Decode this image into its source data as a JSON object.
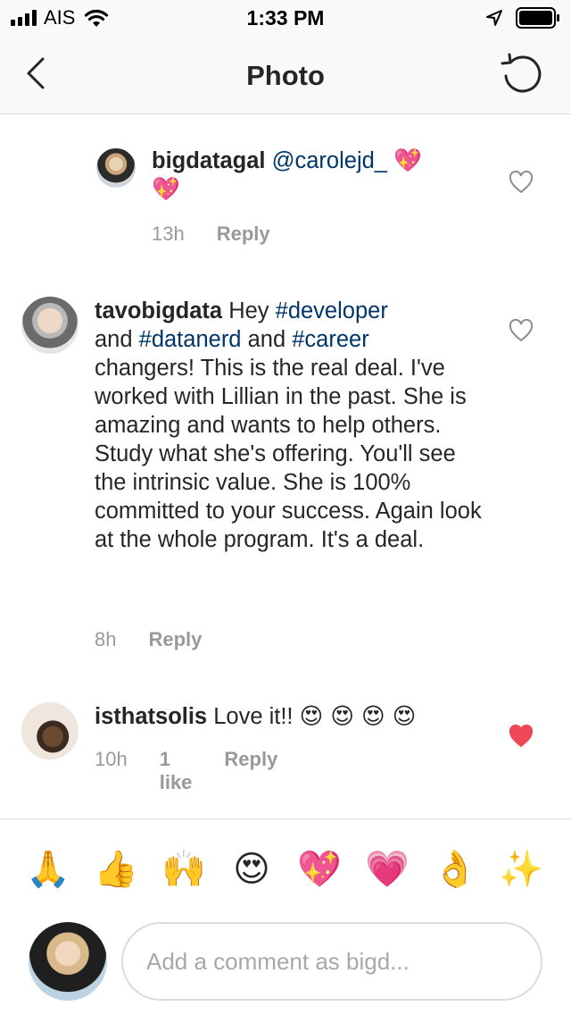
{
  "status_bar": {
    "carrier": "AIS",
    "time": "1:33 PM",
    "icons": [
      "signal-icon",
      "wifi-icon",
      "location-arrow-icon",
      "battery-icon"
    ]
  },
  "nav": {
    "title": "Photo",
    "back_icon": "chevron-left-icon",
    "refresh_icon": "refresh-icon"
  },
  "comments": [
    {
      "username": "bigdatagal",
      "mention": "@carolejd_",
      "emoji": "💖",
      "emoji2": "💖",
      "time": "13h",
      "reply": "Reply",
      "liked": false
    },
    {
      "username": "tavobigdata",
      "text_1": "Hey ",
      "tag_1": "#developer",
      "text_2": "and ",
      "tag_2": "#datanerd",
      "text_3": " and ",
      "tag_3": "#career",
      "text_4": "changers!  This is the real deal. I've worked with Lillian in the past.  She is amazing and wants to help others.  Study what she's offering.  You'll see the intrinsic value.  She is 100% committed to your success.  Again look at the whole program.  It's a deal.",
      "time": "8h",
      "reply": "Reply",
      "liked": false
    },
    {
      "username": "isthatsolis",
      "text": "Love it!!",
      "emojis": "😍 😍 😍 😍",
      "time": "10h",
      "likes": "1 like",
      "reply": "Reply",
      "liked": true
    }
  ],
  "emoji_bar": [
    "🙏",
    "👍",
    "🙌",
    "😍",
    "💖",
    "💗",
    "👌",
    "✨"
  ],
  "input": {
    "placeholder": "Add a comment as bigd..."
  },
  "colors": {
    "link": "#003569",
    "meta": "#999999",
    "heart_liked": "#ed4956",
    "border": "#dbdbdb"
  }
}
